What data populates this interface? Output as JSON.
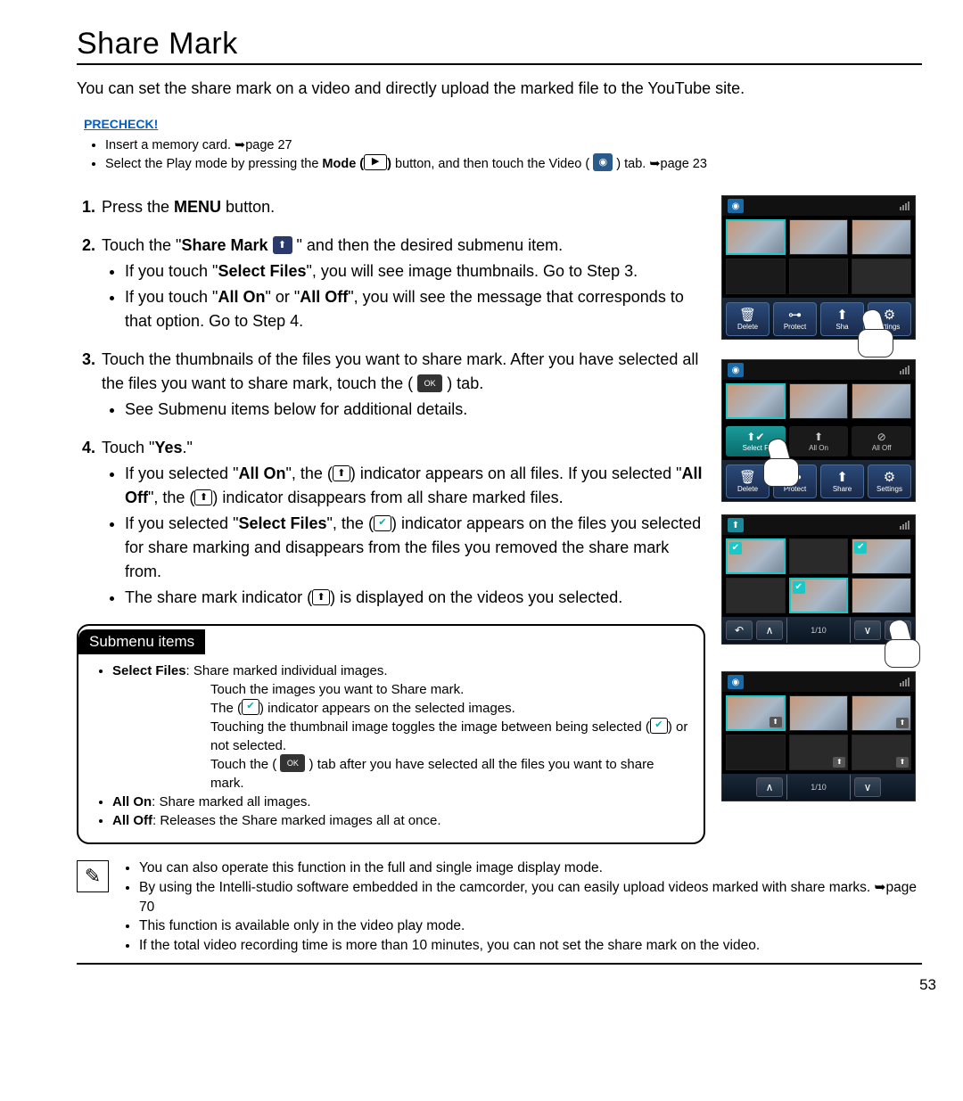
{
  "title": "Share Mark",
  "intro": "You can set the share mark on a video and directly upload the marked file to the YouTube site.",
  "precheck_label": "PRECHECK!",
  "precheck": [
    "Insert a memory card. ➥page 27",
    "Select the Play mode by pressing the Mode ( ▶ ) button, and then touch the Video ( ◉ ) tab. ➥page 23"
  ],
  "steps": {
    "s1": {
      "num": "1.",
      "text_a": "Press the ",
      "bold": "MENU",
      "text_b": " button."
    },
    "s2": {
      "num": "2.",
      "text_a": "Touch the \"",
      "bold": "Share Mark",
      "text_b": " \" and then the desired submenu item.",
      "b1_a": "If you touch \"",
      "b1_bold": "Select Files",
      "b1_b": "\", you will see image thumbnails. Go to Step 3.",
      "b2_a": "If you touch \"",
      "b2_bold1": "All On",
      "b2_mid": "\" or \"",
      "b2_bold2": "All Off",
      "b2_b": "\", you will see the message that corresponds to that option. Go to Step 4."
    },
    "s3": {
      "num": "3.",
      "line1": "Touch the thumbnails of the files you want to share mark. After you have selected all the files you want to share mark, touch the ( ",
      "line1_end": " ) tab.",
      "b1": "See Submenu items below for additional details."
    },
    "s4": {
      "num": "4.",
      "text_a": "Touch \"",
      "bold": "Yes",
      "text_b": ".\"",
      "b1_a": "If you selected \"",
      "b1_bold1": "All On",
      "b1_mid1": "\", the (",
      "b1_mid2": ") indicator appears on all files. If you selected \"",
      "b1_bold2": "All Off",
      "b1_mid3": "\", the (",
      "b1_end": ") indicator disappears from all share marked files.",
      "b2_a": "If you selected \"",
      "b2_bold": "Select Files",
      "b2_mid1": "\", the (",
      "b2_end": ") indicator appears on the files you selected for share marking and disappears from the files you removed the share mark from.",
      "b3_a": "The share mark indicator (",
      "b3_b": ") is displayed on the videos you selected."
    }
  },
  "submenu": {
    "header": "Submenu items",
    "i1_a": "Select Files",
    "i1_b": ": Share marked individual images.",
    "i1_l1": "Touch the images you want to Share mark.",
    "i1_l2a": "The (",
    "i1_l2b": ") indicator appears on the selected images.",
    "i1_l3a": "Touching the thumbnail image toggles the image between being selected (",
    "i1_l3b": ") or not selected.",
    "i1_l4a": "Touch the ( ",
    "i1_l4b": " ) tab after you have selected all the files you want to share mark.",
    "i2_a": "All On",
    "i2_b": ": Share marked all images.",
    "i3_a": "All Off",
    "i3_b": ": Releases the Share marked images all at once."
  },
  "notes": [
    "You can also operate this function in the full and single image display mode.",
    "By using the Intelli-studio software embedded in the camcorder, you can easily upload videos marked with share marks. ➥page 70",
    "This function is available only in the video play mode.",
    "If the total video recording time is more than 10 minutes, you can not set the share mark on the video."
  ],
  "page_number": "53",
  "screens": {
    "toolbar": {
      "delete": "Delete",
      "protect": "Protect",
      "share": "Share",
      "settings": "Settings",
      "share_short": "Sha",
      "settings_short": "ettings"
    },
    "options": {
      "select": "Select F",
      "allon": "All On",
      "alloff": "All Off"
    },
    "counter": "1/10"
  }
}
